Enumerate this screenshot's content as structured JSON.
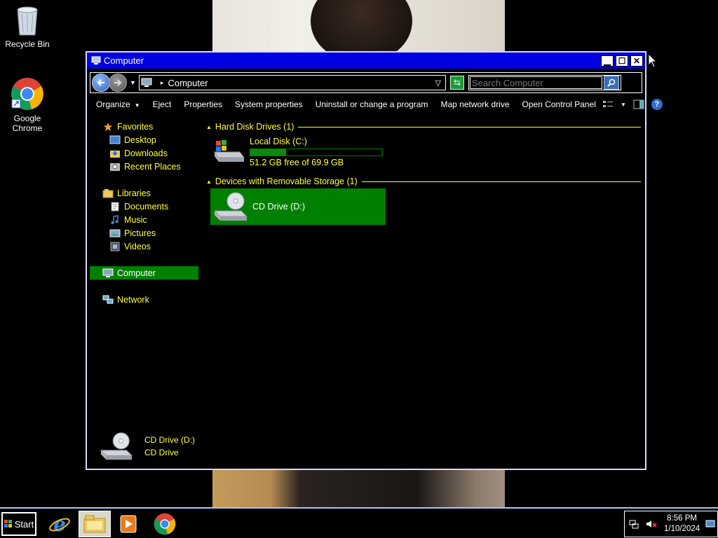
{
  "desktop": {
    "icons": [
      {
        "label": "Recycle Bin",
        "icon": "recycle-bin-icon"
      },
      {
        "label": "Google Chrome",
        "icon": "chrome-icon"
      }
    ]
  },
  "window": {
    "title": "Computer",
    "address": {
      "location": "Computer"
    },
    "search": {
      "placeholder": "Search Computer"
    },
    "commands": {
      "organize": "Organize",
      "eject": "Eject",
      "properties": "Properties",
      "system_properties": "System properties",
      "uninstall": "Uninstall or change a program",
      "map_drive": "Map network drive",
      "control_panel": "Open Control Panel"
    },
    "nav": {
      "favorites": "Favorites",
      "desktop": "Desktop",
      "downloads": "Downloads",
      "recent": "Recent Places",
      "libraries": "Libraries",
      "documents": "Documents",
      "music": "Music",
      "pictures": "Pictures",
      "videos": "Videos",
      "computer": "Computer",
      "network": "Network"
    },
    "groups": {
      "hdd_header": "Hard Disk Drives (1)",
      "removable_header": "Devices with Removable Storage (1)"
    },
    "local_disk": {
      "name": "Local Disk (C:)",
      "free_text": "51.2 GB free of 69.9 GB",
      "used_fraction": 0.27
    },
    "cd_drive": {
      "name": "CD Drive (D:)"
    },
    "details": {
      "name": "CD Drive (D:)",
      "type": "CD Drive"
    }
  },
  "taskbar": {
    "start_label": "Start",
    "clock_time": "8:56 PM",
    "clock_date": "1/10/2024"
  },
  "colors": {
    "nav_text": "#ffff40",
    "selection": "#008000",
    "titlebar": "#0000e0"
  }
}
